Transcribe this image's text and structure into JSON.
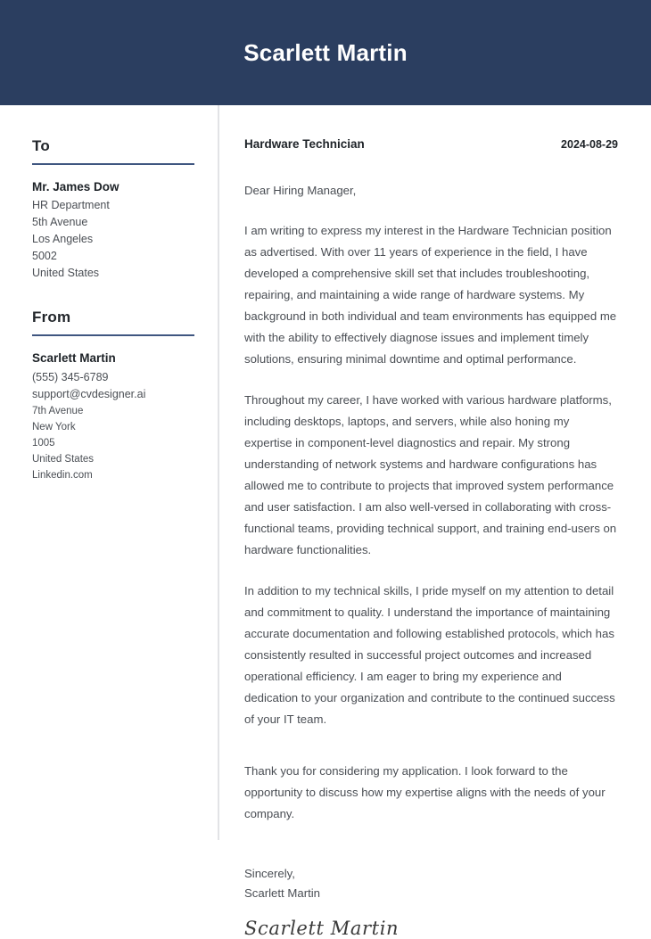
{
  "header": {
    "name": "Scarlett Martin"
  },
  "sidebar": {
    "to": {
      "heading": "To",
      "lines": [
        "Mr. James Dow",
        "HR Department",
        "5th Avenue",
        "Los Angeles",
        "5002",
        "United States"
      ]
    },
    "from": {
      "heading": "From",
      "lines": [
        "Scarlett Martin",
        "(555) 345-6789",
        "support@cvdesigner.ai",
        "7th Avenue",
        "New York",
        "1005",
        "United States",
        "Linkedin.com"
      ]
    }
  },
  "letter": {
    "job_title": "Hardware Technician",
    "date": "2024-08-29",
    "salutation": "Dear Hiring Manager,",
    "paragraphs": [
      "I am writing to express my interest in the Hardware Technician position as advertised. With over 11 years of experience in the field, I have developed a comprehensive skill set that includes troubleshooting, repairing, and maintaining a wide range of hardware systems. My background in both individual and team environments has equipped me with the ability to effectively diagnose issues and implement timely solutions, ensuring minimal downtime and optimal performance.",
      "Throughout my career, I have worked with various hardware platforms, including desktops, laptops, and servers, while also honing my expertise in component-level diagnostics and repair. My strong understanding of network systems and hardware configurations has allowed me to contribute to projects that improved system performance and user satisfaction. I am also well-versed in collaborating with cross-functional teams, providing technical support, and training end-users on hardware functionalities.",
      "In addition to my technical skills, I pride myself on my attention to detail and commitment to quality. I understand the importance of maintaining accurate documentation and following established protocols, which has consistently resulted in successful project outcomes and increased operational efficiency. I am eager to bring my experience and dedication to your organization and contribute to the continued success of your IT team."
    ],
    "closing_paragraph": "Thank you for considering my application. I look forward to the opportunity to discuss how my expertise aligns with the needs of your company.",
    "sign_off": "Sincerely,",
    "sign_name": "Scarlett Martin",
    "signature": "Scarlett Martin"
  },
  "colors": {
    "header_navy": "#2b3e60",
    "rule_navy": "#3f5680",
    "divider_gray": "#e2e3e6"
  }
}
